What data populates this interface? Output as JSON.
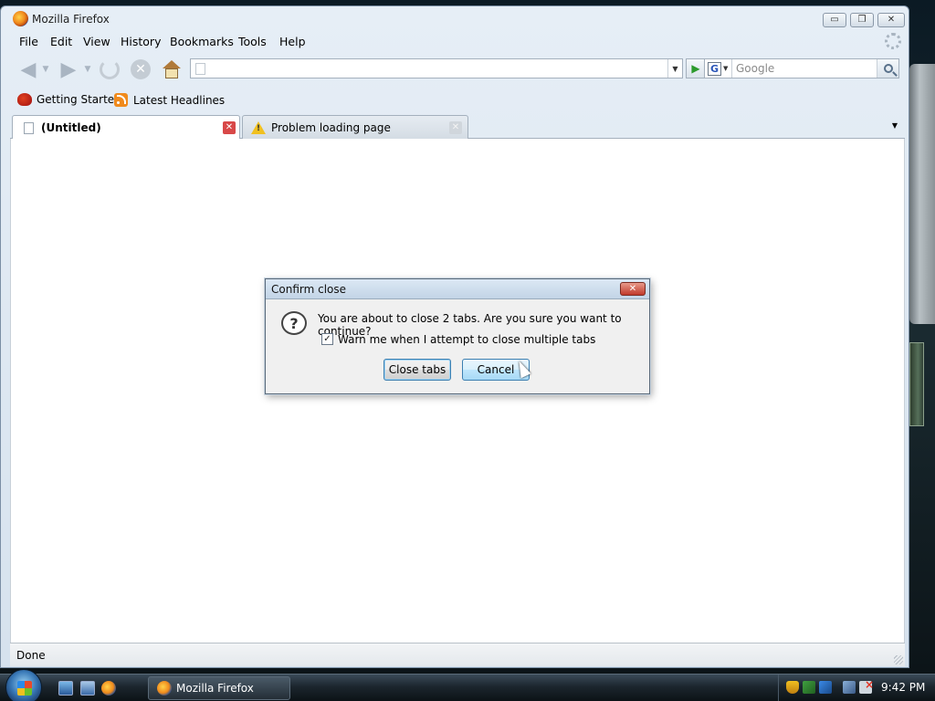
{
  "window": {
    "title": "Mozilla Firefox",
    "controls": {
      "minimize": "▭",
      "maximize": "❐",
      "close": "✕"
    }
  },
  "menu": {
    "items": [
      "File",
      "Edit",
      "View",
      "History",
      "Bookmarks",
      "Tools",
      "Help"
    ]
  },
  "navigation": {
    "url_value": "",
    "search_placeholder": "Google",
    "search_engine": "G",
    "icons": [
      "back-icon",
      "forward-icon",
      "reload-icon",
      "stop-icon",
      "home-icon",
      "go-icon",
      "search-icon"
    ]
  },
  "bookmarks": {
    "items": [
      "Getting Started",
      "Latest Headlines"
    ]
  },
  "tabs": [
    {
      "label": "(Untitled)",
      "active": true
    },
    {
      "label": "Problem loading page",
      "active": false
    }
  ],
  "status": {
    "text": "Done"
  },
  "dialog": {
    "title": "Confirm close",
    "message": "You are about to close 2 tabs. Are you sure you want to continue?",
    "checkbox_label": "Warn me when I attempt to close multiple tabs",
    "checkbox_checked": true,
    "buttons": {
      "confirm": "Close tabs",
      "cancel": "Cancel"
    }
  },
  "taskbar": {
    "window_button": "Mozilla Firefox",
    "clock": "9:42 PM"
  }
}
